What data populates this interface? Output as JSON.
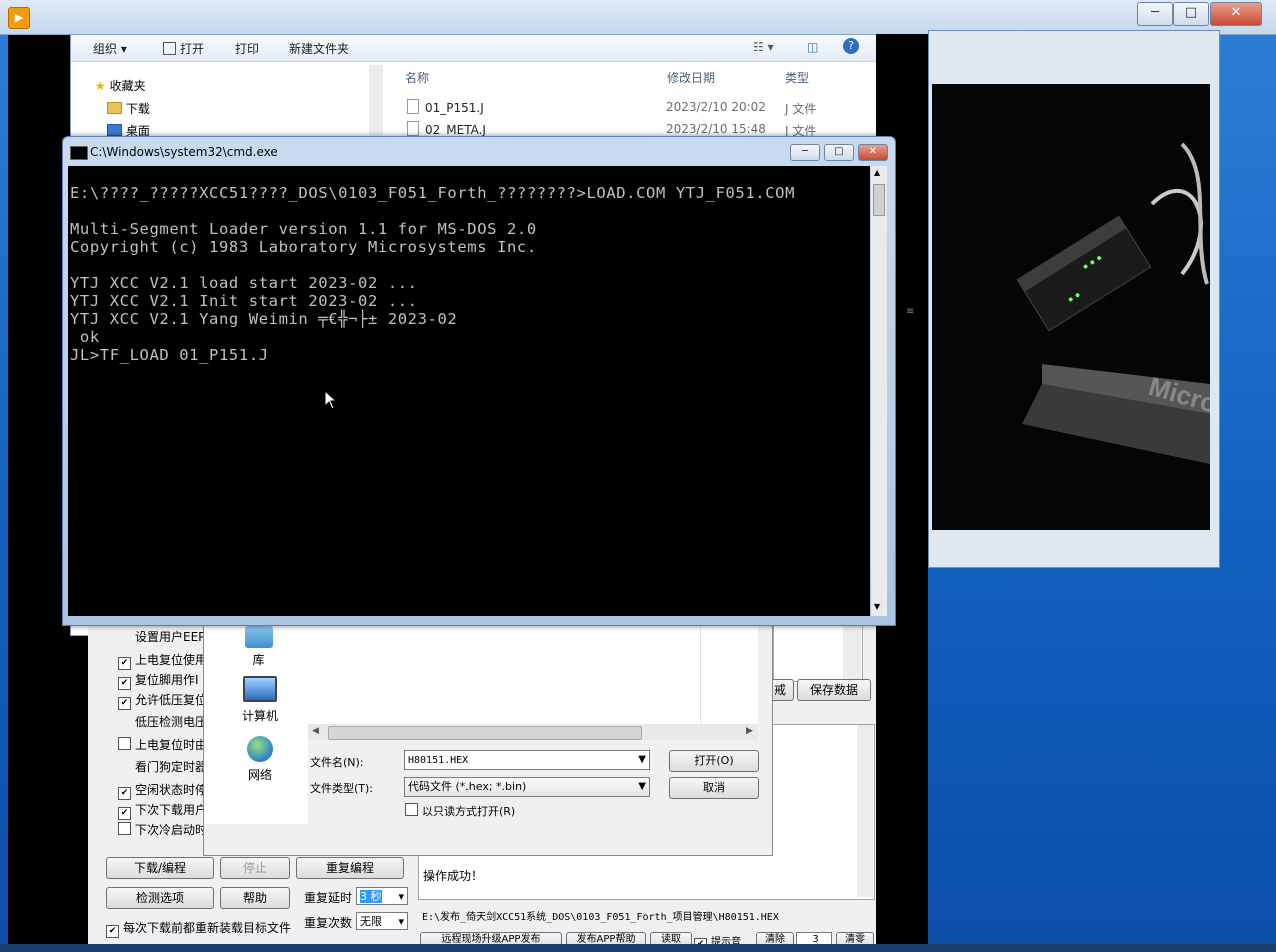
{
  "app": {
    "icon_glyph": "▶"
  },
  "window_controls": {
    "minimize": "─",
    "maximize": "□",
    "close": "✕"
  },
  "explorer": {
    "toolbar": [
      "组织 ▾",
      "打开",
      "打印",
      "新建文件夹"
    ],
    "nav": {
      "favorites": "收藏夹",
      "downloads": "下载",
      "desktop": "桌面"
    },
    "columns": {
      "name": "名称",
      "date": "修改日期",
      "type": "类型"
    },
    "files": [
      {
        "name": "01_P151.J",
        "date": "2023/2/10 20:02",
        "type": "J 文件"
      },
      {
        "name": "02_META.J",
        "date": "2023/2/10 15:48",
        "type": "J 文件"
      }
    ]
  },
  "cmd": {
    "title": "C:\\Windows\\system32\\cmd.exe",
    "lines": [
      "E:\\????_?????XCC51????_DOS\\0103_F051_Forth_????????>LOAD.COM YTJ_F051.COM",
      "",
      "Multi-Segment Loader version 1.1 for MS-DOS 2.0",
      "Copyright (c) 1983 Laboratory Microsystems Inc.",
      "",
      "YTJ XCC V2.1 load start 2023-02 ...",
      "YTJ XCC V2.1 Init start 2023-02 ...",
      "YTJ XCC V2.1 Yang Weimin ╤€╬¬├± 2023-02",
      " ok",
      "JL>TF_LOAD 01_P151.J"
    ]
  },
  "isp": {
    "options": [
      {
        "label": "设置用户EEP",
        "checked": null
      },
      {
        "label": "上电复位使用",
        "checked": true
      },
      {
        "label": "复位脚用作I",
        "checked": true
      },
      {
        "label": "允许低压复位",
        "checked": true
      },
      {
        "label": "低压检测电压",
        "checked": null
      },
      {
        "label": "上电复位时由",
        "checked": false
      },
      {
        "label": "看门狗定时器",
        "checked": null
      },
      {
        "label": "空闲状态时停",
        "checked": true
      },
      {
        "label": "下次下载用户",
        "checked": true
      },
      {
        "label": "下次冷启动时",
        "checked": false
      }
    ],
    "buttons": {
      "download": "下载/编程",
      "stop": "停止",
      "reprogram": "重复编程",
      "check": "检测选项",
      "help": "帮助",
      "save_data": "保存数据",
      "cut": "戒"
    },
    "repeat_delay_label": "重复延时",
    "repeat_delay_value": "3 秒",
    "repeat_count_label": "重复次数",
    "repeat_count_value": "无限",
    "reload_label": "每次下载前都重新装载目标文件",
    "message": "操作成功！",
    "path": "E:\\发布_倚天剑XCC51系统_DOS\\0103_F051_Forth_项目管理\\H80151.HEX",
    "bottom_buttons": [
      "远程现场升级APP发布",
      "发布APP帮助",
      "读取",
      "提示音",
      "清除",
      "3",
      "清零"
    ]
  },
  "open_dialog": {
    "nav": {
      "library": "库",
      "computer": "计算机",
      "network": "网络"
    },
    "filename_label": "文件名(N):",
    "filename_value": "H80151.HEX",
    "filetype_label": "文件类型(T):",
    "filetype_value": "代码文件 (*.hex; *.bin)",
    "readonly_label": "以只读方式打开(R)",
    "open_button": "打开(O)",
    "cancel_button": "取消"
  }
}
